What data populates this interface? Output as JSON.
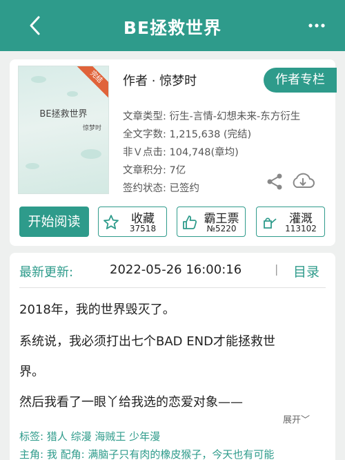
{
  "header": {
    "title": "BE拯救世界",
    "icons": {
      "back": "chevron-left-icon",
      "more": "more-dots-icon"
    }
  },
  "book": {
    "cover": {
      "title": "BE拯救世界",
      "author": "惊梦时",
      "badge": "完结"
    },
    "author_line": "作者 · 惊梦时",
    "author_column_button": "作者专栏",
    "info": [
      "文章类型: 衍生-言情-幻想未来-东方衍生",
      "全文字数: 1,215,638 (完结)",
      "非Ｖ点击: 104,748(章均)",
      "文章积分: 7亿",
      "签约状态: 已签约"
    ]
  },
  "actions": {
    "read": "开始阅读",
    "collect": {
      "label": "收藏",
      "count": "37518",
      "icon": "star-icon"
    },
    "vote": {
      "label": "霸王票",
      "count": "№5220",
      "icon": "thumbs-up-icon"
    },
    "water": {
      "label": "灌溉",
      "count": "113102",
      "icon": "watering-can-icon"
    }
  },
  "update": {
    "label": "最新更新:",
    "time": "2022-05-26 16:00:16",
    "separator": "|",
    "toc": "目录"
  },
  "summary": {
    "lines": [
      "2018年，我的世界毁灭了。",
      "系统说，我必须打出七个BAD END才能拯救世",
      "界。",
      "然后我看了一眼丫给我选的恋爱对象——"
    ],
    "expand": "展开﹀"
  },
  "tags": "标签:  猎人  综漫  海贼王  少年漫",
  "roles": "主角:  我          配角:  满脑子只有肉的橡皮猴子，今天也有可能",
  "colors": {
    "accent": "#2e9b8b",
    "badge": "#e0633a",
    "background": "#eef0ef"
  }
}
